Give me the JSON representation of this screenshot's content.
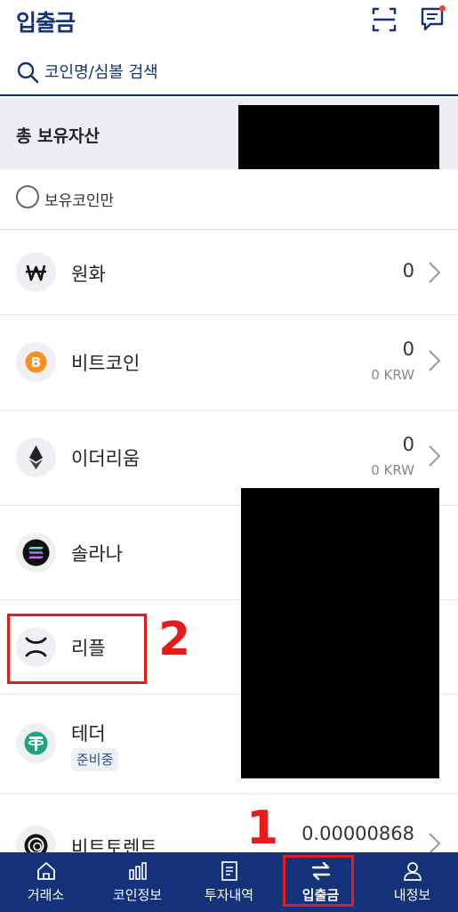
{
  "header": {
    "title": "입출금"
  },
  "search": {
    "placeholder": "코인명/심볼 검색"
  },
  "total": {
    "label": "총 보유자산",
    "value_tail": "/"
  },
  "filter": {
    "label": "보유코인만"
  },
  "assets": [
    {
      "name": "원화",
      "amount": "0",
      "krw": "",
      "icon": "won-icon"
    },
    {
      "name": "비트코인",
      "amount": "0",
      "krw": "0 KRW",
      "icon": "bitcoin-icon"
    },
    {
      "name": "이더리움",
      "amount": "0",
      "krw": "0 KRW",
      "icon": "ethereum-icon"
    },
    {
      "name": "솔라나",
      "amount": "",
      "krw": "",
      "icon": "solana-icon"
    },
    {
      "name": "리플",
      "amount": "",
      "krw": "",
      "icon": "ripple-icon"
    },
    {
      "name": "테더",
      "badge": "준비중",
      "amount": "",
      "krw": "",
      "icon": "tether-icon"
    },
    {
      "name": "비트토렌트",
      "amount": "0.00000868",
      "krw": "",
      "icon": "bittorrent-icon"
    }
  ],
  "annotations": {
    "one": "1",
    "two": "2"
  },
  "tabs": [
    {
      "label": "거래소",
      "icon": "home-icon"
    },
    {
      "label": "코인정보",
      "icon": "chart-icon"
    },
    {
      "label": "투자내역",
      "icon": "document-icon"
    },
    {
      "label": "입출금",
      "icon": "transfer-icon",
      "active": true
    },
    {
      "label": "내정보",
      "icon": "person-icon"
    }
  ],
  "colors": {
    "brand": "#13327a",
    "annotation": "#e81b1b",
    "bitcoin": "#f7931a",
    "tether": "#26a17b"
  }
}
